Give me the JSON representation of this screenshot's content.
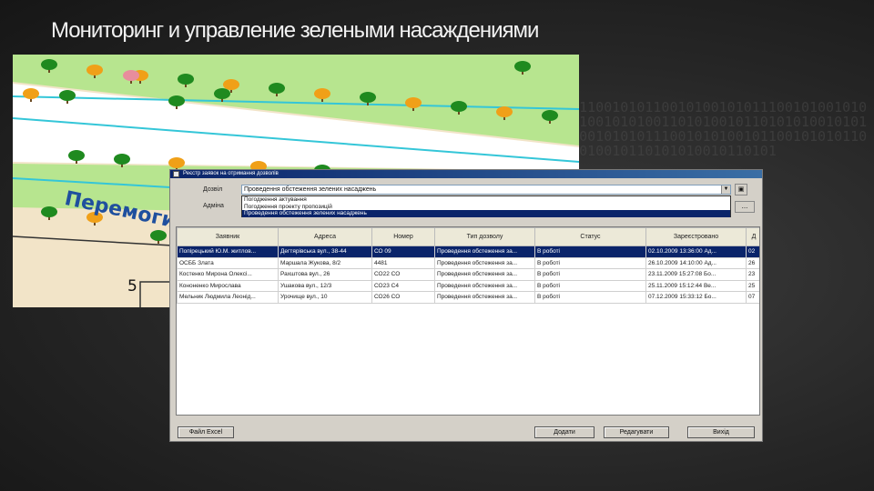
{
  "slide": {
    "title": "Мониторинг и управление зелеными насаждениями"
  },
  "background": {
    "binary": "0101110010101100101001010111001010010101011100101010011010100101101010100101011101001010101110010101001011001010101100101010010110101010010110101"
  },
  "map": {
    "street_label": "Перемоги просп",
    "house_number": "5",
    "colors": {
      "ground": "#f2e4c8",
      "lawn": "#b7e58f",
      "road": "#ffffff",
      "road_line": "#34c6d8",
      "tree_green": "#1f8a1f",
      "tree_orange": "#f0a018",
      "tree_pink": "#e88d9c"
    }
  },
  "window": {
    "title": "Реєстр заявок на отримання дозволів",
    "permit_label": "Дозвіл",
    "action_label": "Адміна",
    "combo_value": "Проведення обстеження зелених насаджень",
    "combo_button_icon": "lookup-icon",
    "dropdown_options": [
      "Погодження актування",
      "Погодження проекту пропозицій",
      "Проведення обстеження зелених насаджень"
    ],
    "ellipsis_label": "...",
    "columns": [
      "Заявник",
      "Адреса",
      "Номер",
      "Тип дозволу",
      "Статус",
      "Зареєстровано",
      "Д"
    ],
    "rows": [
      [
        "Попірецький Ю.М. житлов...",
        "Дегтярівська вул., 38-44",
        "СО 09",
        "Проведення обстеження за...",
        "В роботі",
        "02.10.2009 13:36:00 Ад...",
        "02"
      ],
      [
        "ОСББ Злата",
        "Маршала Жукова, 8/2",
        "4481",
        "Проведення обстеження за...",
        "В роботі",
        "26.10.2009 14:10:00 Ад...",
        "26"
      ],
      [
        "Костенко Мирона Олексі...",
        "Рахштова вул., 26",
        "СО22 СО",
        "Проведення обстеження за...",
        "В роботі",
        "23.11.2009 15:27:08 Бо...",
        "23"
      ],
      [
        "Кононенко Мирослава",
        "Ушакова вул., 12/3",
        "СО23 С4",
        "Проведення обстеження за...",
        "В роботі",
        "25.11.2009 15:12:44 Ве...",
        "25"
      ],
      [
        "Мельник Людмила Леонід...",
        "Урочище вул., 10",
        "СО26 СО",
        "Проведення обстеження за...",
        "В роботі",
        "07.12.2009 15:33:12 Бо...",
        "07"
      ]
    ],
    "buttons": {
      "export": "Файл Excel",
      "add": "Додати",
      "edit": "Редагувати",
      "exit": "Вихід"
    }
  }
}
